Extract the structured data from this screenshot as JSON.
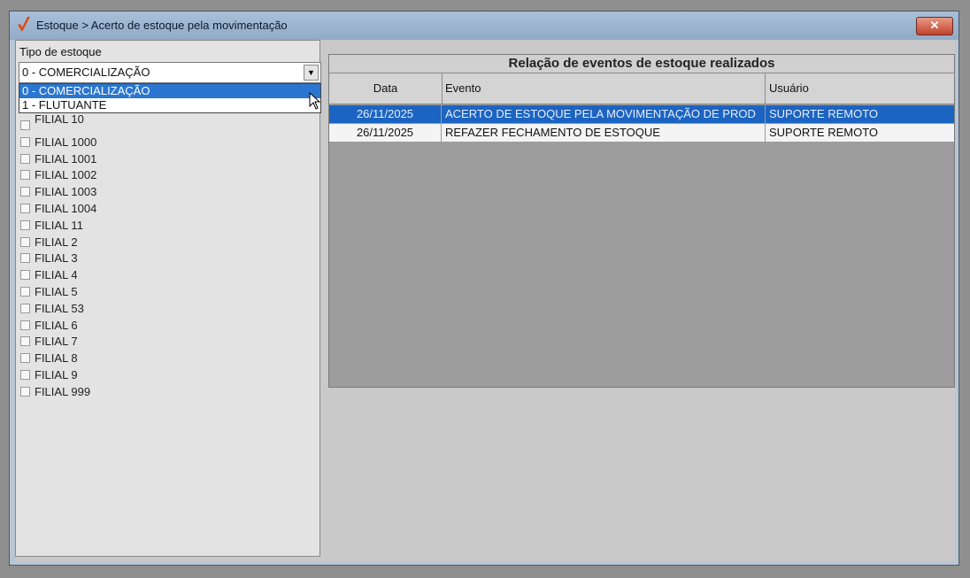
{
  "window": {
    "title": "Estoque > Acerto de estoque pela movimentação",
    "close_glyph": "✕"
  },
  "left": {
    "tipo_label": "Tipo de estoque",
    "combo_value": "0 - COMERCIALIZAÇÃO",
    "combo_arrow": "▼",
    "dropdown_options": [
      "0 - COMERCIALIZAÇÃO",
      "1 - FLUTUANTE"
    ],
    "selected_option_index": 0,
    "filiais": [
      "FILIAL 10",
      "FILIAL 1000",
      "FILIAL 1001",
      "FILIAL 1002",
      "FILIAL 1003",
      "FILIAL 1004",
      "FILIAL 11",
      "FILIAL 2",
      "FILIAL 3",
      "FILIAL 4",
      "FILIAL 5",
      "FILIAL 53",
      "FILIAL 6",
      "FILIAL 7",
      "FILIAL 8",
      "FILIAL 9",
      "FILIAL 999"
    ]
  },
  "grid": {
    "title": "Relação de eventos de estoque realizados",
    "columns": {
      "data": "Data",
      "evento": "Evento",
      "usuario": "Usuário"
    },
    "rows": [
      {
        "data": "26/11/2025",
        "evento": "ACERTO DE ESTOQUE PELA MOVIMENTAÇÃO DE PROD",
        "usuario": "SUPORTE REMOTO",
        "selected": true
      },
      {
        "data": "26/11/2025",
        "evento": "REFAZER FECHAMENTO DE ESTOQUE",
        "usuario": "SUPORTE REMOTO",
        "selected": false
      }
    ]
  },
  "colors": {
    "selection": "#1c64c2",
    "dropdown_selection": "#2a76d0",
    "title_gradient_top": "#a9c0da",
    "close_button": "#c3432c",
    "app_icon": "#e04a17"
  },
  "icons": {
    "app": "check-mark-icon",
    "close": "close-icon",
    "combo_arrow": "chevron-down-icon",
    "cursor": "mouse-pointer-icon"
  }
}
